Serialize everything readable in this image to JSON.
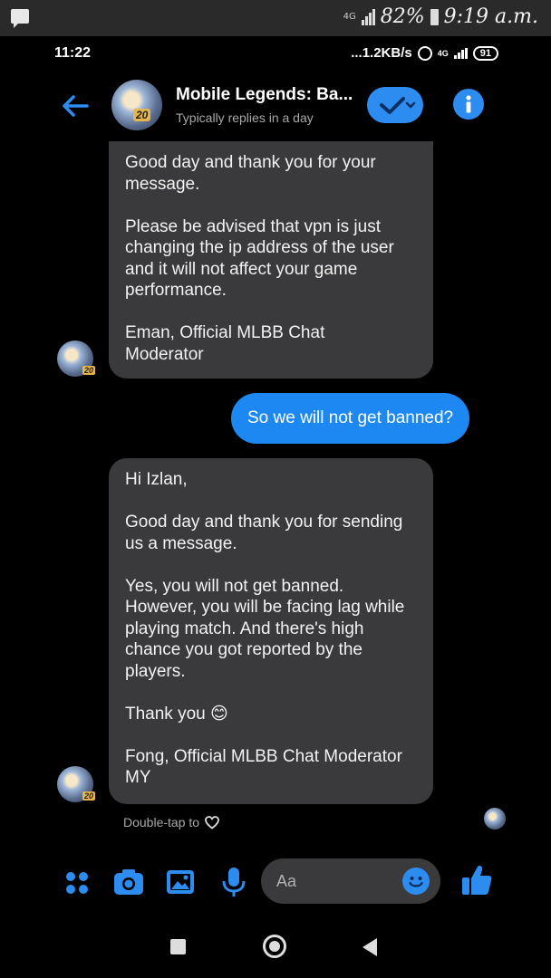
{
  "device_status": {
    "network": "4G",
    "battery": "82%",
    "time": "9:19 a.m."
  },
  "status": {
    "time": "11:22",
    "speed": "...1.2KB/s",
    "network": "4G",
    "battery": "91"
  },
  "header": {
    "title": "Mobile Legends: Ba...",
    "subtitle": "Typically replies in a day",
    "avatar_badge": "20"
  },
  "messages": {
    "m1": {
      "p1": "Good day and thank you for your message.",
      "p2": "Please be advised that vpn is just changing the ip address of the user and it will not affect your game performance.",
      "p3": "Eman, Official MLBB Chat Moderator"
    },
    "m2": {
      "text": "So we will not get banned?"
    },
    "m3": {
      "p1": "Hi Izlan,",
      "p2": "Good day and thank you for sending us a message.",
      "p3": "Yes, you will not get banned. However, you will be facing lag while playing match. And there's high chance you got reported by the players.",
      "p4": "Thank you 😊",
      "p5": "Fong, Official MLBB Chat Moderator MY"
    }
  },
  "hint": "Double-tap to",
  "composer": {
    "placeholder": "Aa"
  },
  "colors": {
    "accent": "#2d8cf0",
    "outgoing_bubble": "#1e88f2",
    "incoming_bubble": "#3a3a3c"
  }
}
